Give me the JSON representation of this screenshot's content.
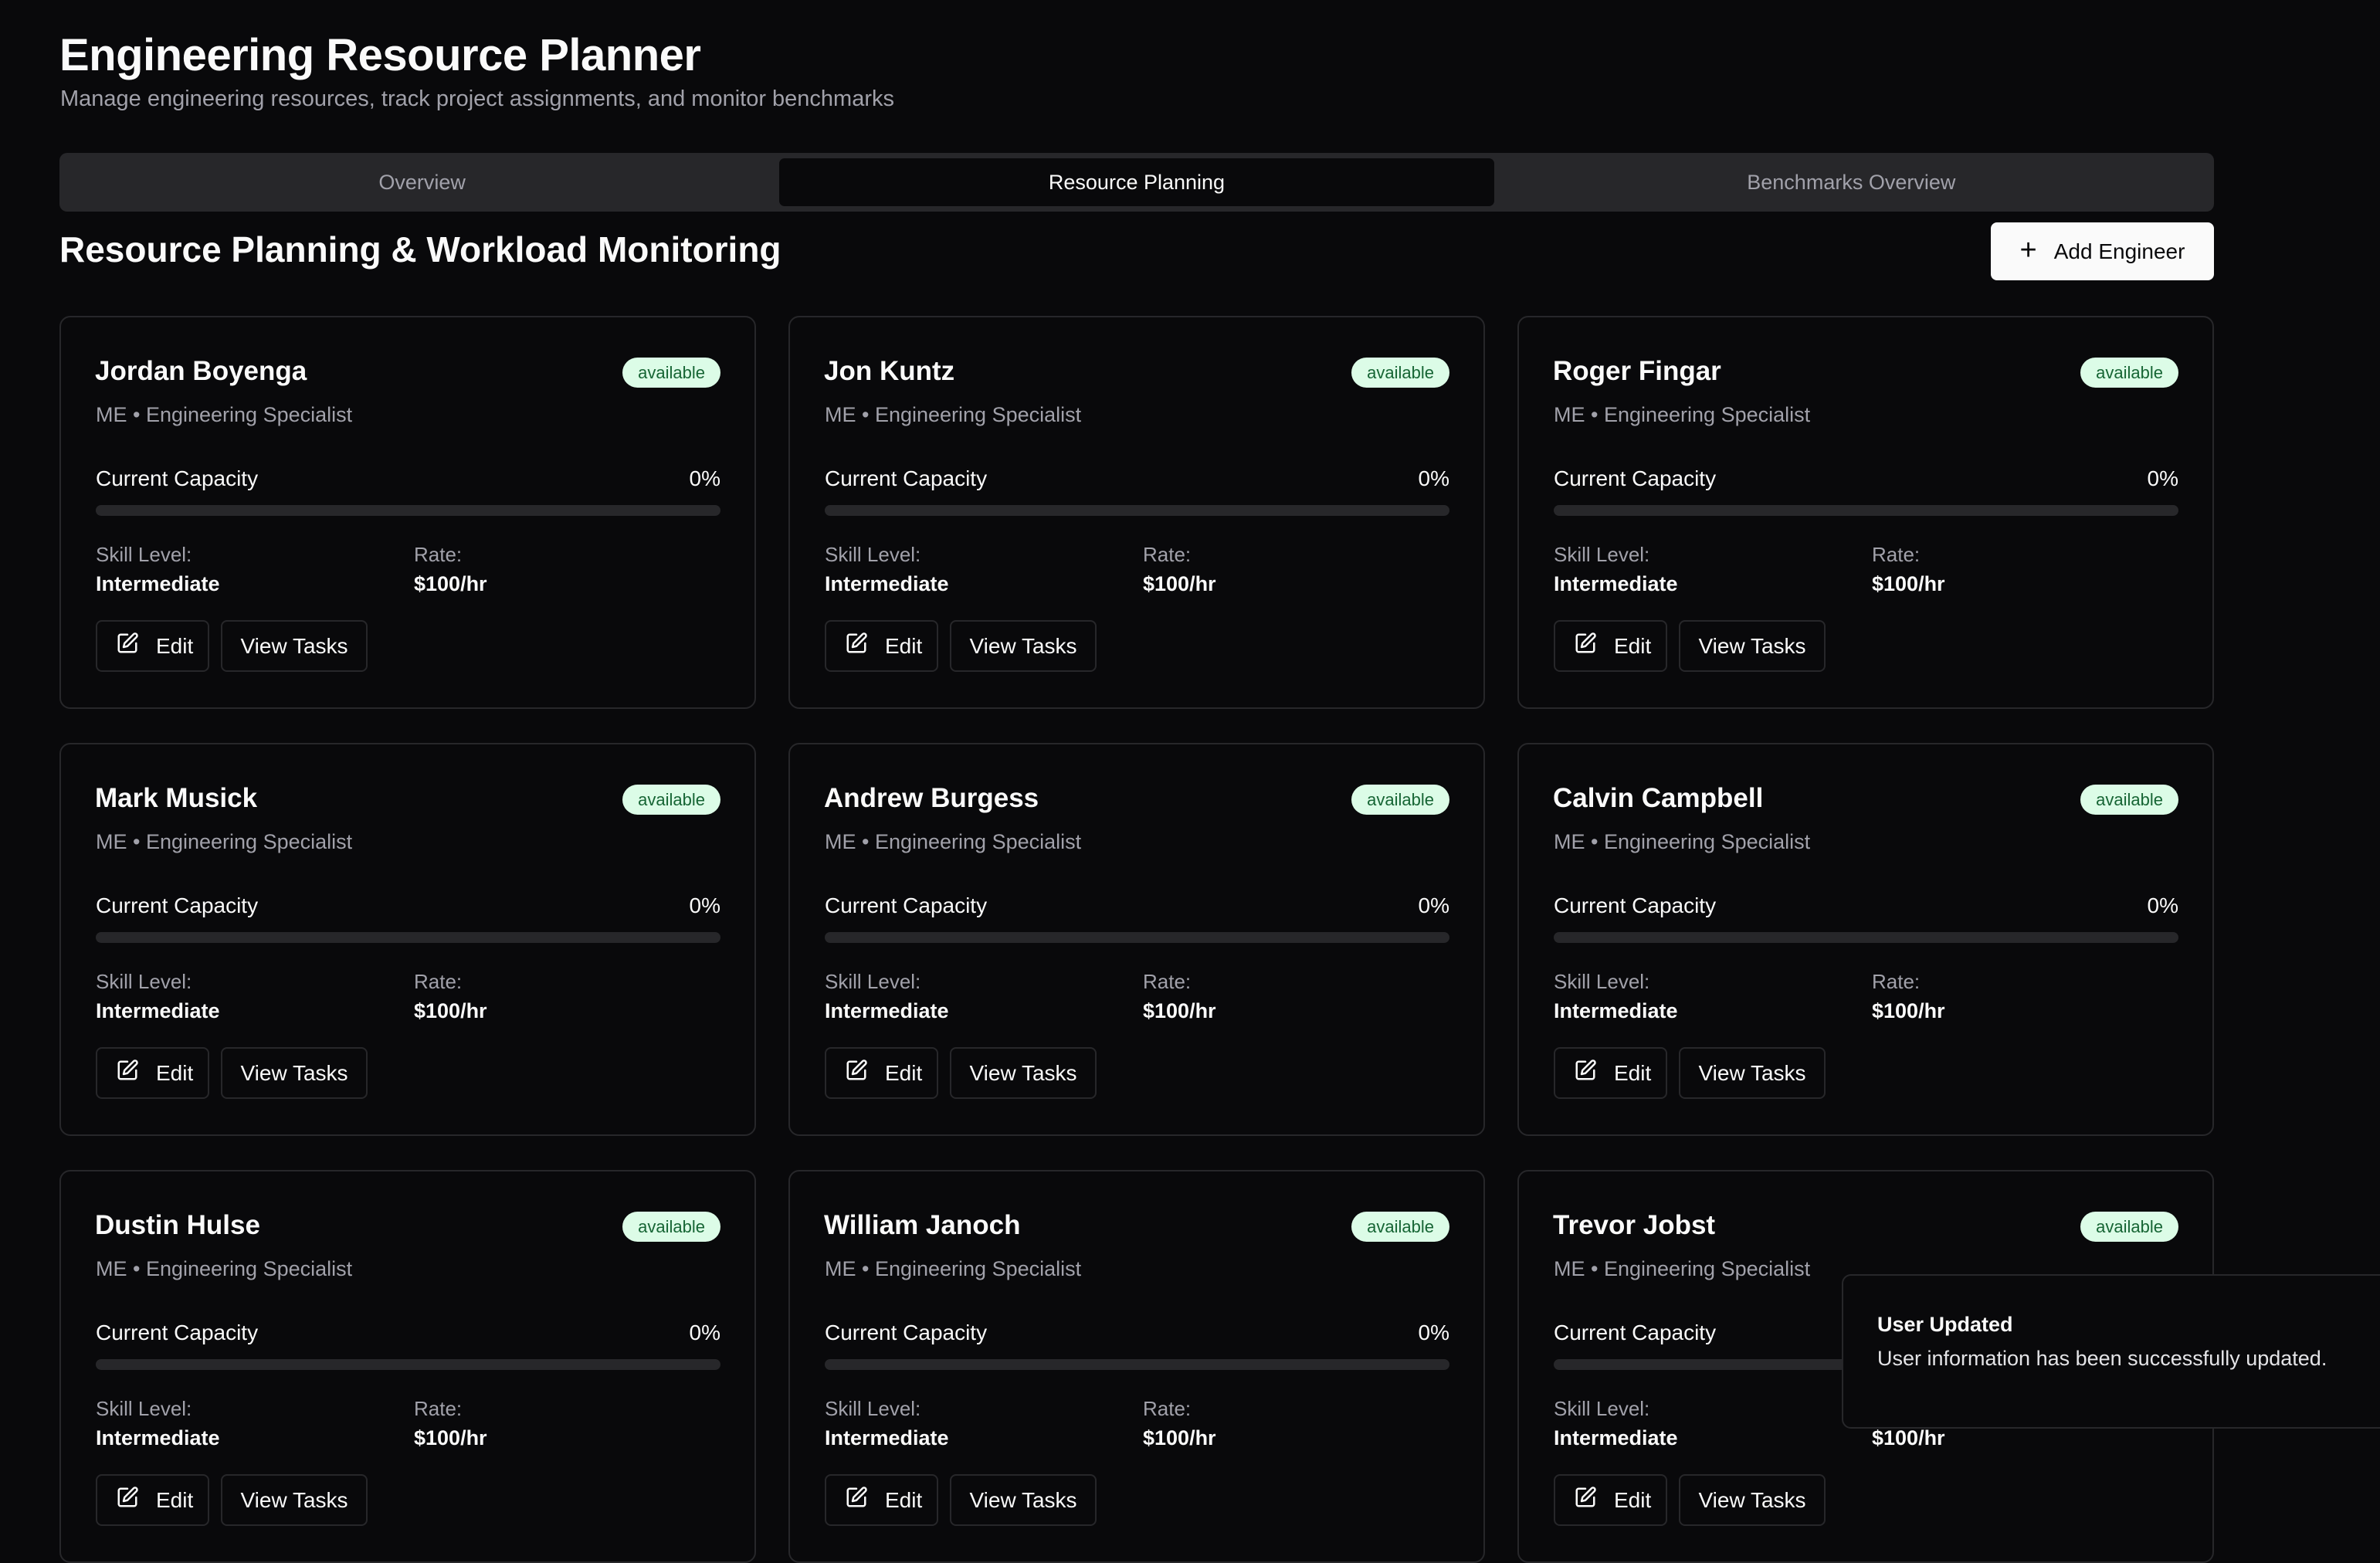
{
  "header": {
    "title": "Engineering Resource Planner",
    "subtitle": "Manage engineering resources, track project assignments, and monitor benchmarks"
  },
  "tabs": [
    {
      "label": "Overview",
      "active": false
    },
    {
      "label": "Resource Planning",
      "active": true
    },
    {
      "label": "Benchmarks Overview",
      "active": false
    }
  ],
  "section": {
    "title": "Resource Planning & Workload Monitoring",
    "add_button": "Add Engineer",
    "add_icon": "plus-icon"
  },
  "labels": {
    "capacity": "Current Capacity",
    "skill": "Skill Level:",
    "rate": "Rate:",
    "edit": "Edit",
    "view_tasks": "View Tasks"
  },
  "engineers": [
    {
      "name": "Jordan Boyenga",
      "status": "available",
      "role": "ME • Engineering Specialist",
      "capacity": "0%",
      "capacity_fraction": 0,
      "skill": "Intermediate",
      "rate": "$100/hr"
    },
    {
      "name": "Jon Kuntz",
      "status": "available",
      "role": "ME • Engineering Specialist",
      "capacity": "0%",
      "capacity_fraction": 0,
      "skill": "Intermediate",
      "rate": "$100/hr"
    },
    {
      "name": "Roger Fingar",
      "status": "available",
      "role": "ME • Engineering Specialist",
      "capacity": "0%",
      "capacity_fraction": 0,
      "skill": "Intermediate",
      "rate": "$100/hr"
    },
    {
      "name": "Mark Musick",
      "status": "available",
      "role": "ME • Engineering Specialist",
      "capacity": "0%",
      "capacity_fraction": 0,
      "skill": "Intermediate",
      "rate": "$100/hr"
    },
    {
      "name": "Andrew Burgess",
      "status": "available",
      "role": "ME • Engineering Specialist",
      "capacity": "0%",
      "capacity_fraction": 0,
      "skill": "Intermediate",
      "rate": "$100/hr"
    },
    {
      "name": "Calvin Campbell",
      "status": "available",
      "role": "ME • Engineering Specialist",
      "capacity": "0%",
      "capacity_fraction": 0,
      "skill": "Intermediate",
      "rate": "$100/hr"
    },
    {
      "name": "Dustin Hulse",
      "status": "available",
      "role": "ME • Engineering Specialist",
      "capacity": "0%",
      "capacity_fraction": 0,
      "skill": "Intermediate",
      "rate": "$100/hr"
    },
    {
      "name": "William Janoch",
      "status": "available",
      "role": "ME • Engineering Specialist",
      "capacity": "0%",
      "capacity_fraction": 0,
      "skill": "Intermediate",
      "rate": "$100/hr"
    },
    {
      "name": "Trevor Jobst",
      "status": "available",
      "role": "ME • Engineering Specialist",
      "capacity": "0%",
      "capacity_fraction": 0,
      "skill": "Intermediate",
      "rate": "$100/hr"
    }
  ],
  "toast": {
    "title": "User Updated",
    "description": "User information has been successfully updated."
  },
  "colors": {
    "background": "#09090b",
    "surface": "#27272a",
    "badge_bg": "#dcfce7",
    "badge_text": "#166534",
    "muted_text": "#a1a1aa"
  }
}
